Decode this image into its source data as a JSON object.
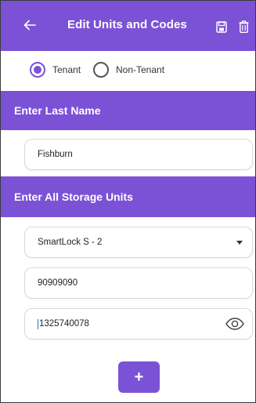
{
  "appbar": {
    "title": "Edit Units and Codes",
    "back_icon": "arrow-left-icon",
    "save_icon": "save-icon",
    "delete_icon": "trash-icon"
  },
  "tenant_type": {
    "options": [
      "Tenant",
      "Non-Tenant"
    ],
    "selected": "Tenant"
  },
  "last_name_section": {
    "header": "Enter Last Name",
    "value": "Fishburn"
  },
  "storage_units_section": {
    "header": "Enter All Storage Units",
    "unit_select_value": "SmartLock S - 2",
    "unit_number_value": "90909090",
    "code_value": "1325740078"
  },
  "add_button_label": "+",
  "colors": {
    "accent": "#7b52d6"
  }
}
